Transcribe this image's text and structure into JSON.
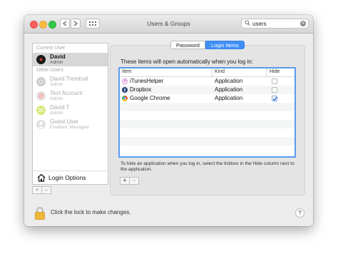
{
  "window": {
    "title": "Users & Groups"
  },
  "search": {
    "value": "users"
  },
  "sidebar": {
    "current_user_header": "Current User",
    "other_users_header": "Other Users",
    "current_user": {
      "name": "David",
      "role": "Admin"
    },
    "other_users": [
      {
        "name": "David Tremholt",
        "role": "Admin"
      },
      {
        "name": "Test Account",
        "role": "Admin"
      },
      {
        "name": "David T",
        "role": "Admin"
      },
      {
        "name": "Guest User",
        "role": "Enabled, Managed"
      }
    ],
    "login_options": "Login Options",
    "add": "+",
    "remove": "−"
  },
  "tabs": [
    {
      "label": "Password"
    },
    {
      "label": "Login Items"
    }
  ],
  "login_items": {
    "lead": "These items will open automatically when you log in:",
    "columns": {
      "item": "Item",
      "kind": "Kind",
      "hide": "Hide"
    },
    "rows": [
      {
        "name": "iTunesHelper",
        "kind": "Application",
        "hide": false
      },
      {
        "name": "Dropbox",
        "kind": "Application",
        "hide": false
      },
      {
        "name": "Google Chrome",
        "kind": "Application",
        "hide": true
      }
    ],
    "hint": "To hide an application when you log in, select the tickbox in the Hide column next to the application.",
    "add": "+",
    "remove": "−"
  },
  "footer": {
    "lock_text": "Click the lock to make changes.",
    "help": "?"
  },
  "colors": {
    "accent": "#3f8ff7",
    "selection": "#d7d7d7"
  }
}
